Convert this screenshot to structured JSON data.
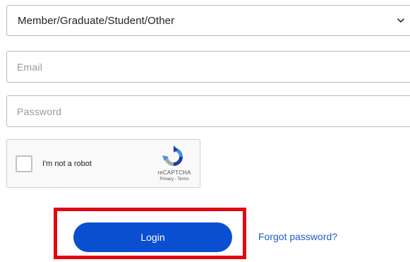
{
  "form": {
    "account_type": {
      "value": "Member/Graduate/Student/Other",
      "icon": "chevron-down-icon"
    },
    "email": {
      "placeholder": "Email"
    },
    "password": {
      "placeholder": "Password"
    },
    "captcha": {
      "label": "I'm not a robot",
      "brand": "reCAPTCHA",
      "links": "Privacy - Terms",
      "icon": "recaptcha-logo-icon"
    },
    "login_label": "Login",
    "forgot_label": "Forgot password?"
  },
  "colors": {
    "primary_button": "#0a4fd1",
    "link": "#1f5fc7",
    "highlight": "#e30613"
  }
}
